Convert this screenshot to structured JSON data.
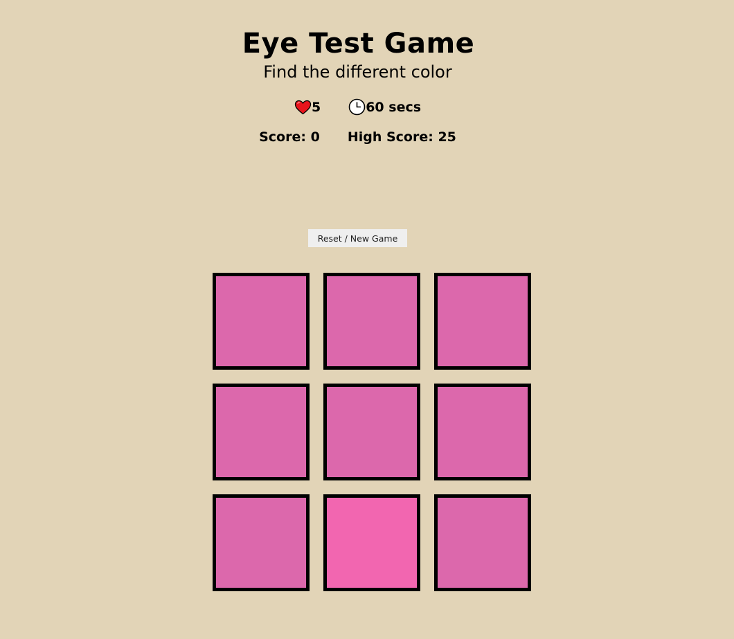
{
  "header": {
    "title": "Eye Test Game",
    "subtitle": "Find the different color"
  },
  "stats": {
    "lives_icon": "heart-icon",
    "lives": "5",
    "timer_icon": "clock-icon",
    "time": "60 secs",
    "score": "Score: 0",
    "high_score": "High Score: 25"
  },
  "controls": {
    "reset_label": "Reset / New Game"
  },
  "colors": {
    "background": "#e2d4b7",
    "tile_base": "#dc68ac",
    "tile_odd": "#f266b0",
    "tile_border": "#000000",
    "heart": "#e8141c"
  },
  "board": {
    "rows": 3,
    "cols": 3,
    "tiles": [
      {
        "color": "#dc68ac"
      },
      {
        "color": "#dc68ac"
      },
      {
        "color": "#dc68ac"
      },
      {
        "color": "#dc68ac"
      },
      {
        "color": "#dc68ac"
      },
      {
        "color": "#dc68ac"
      },
      {
        "color": "#dc68ac"
      },
      {
        "color": "#f266b0"
      },
      {
        "color": "#dc68ac"
      }
    ]
  }
}
